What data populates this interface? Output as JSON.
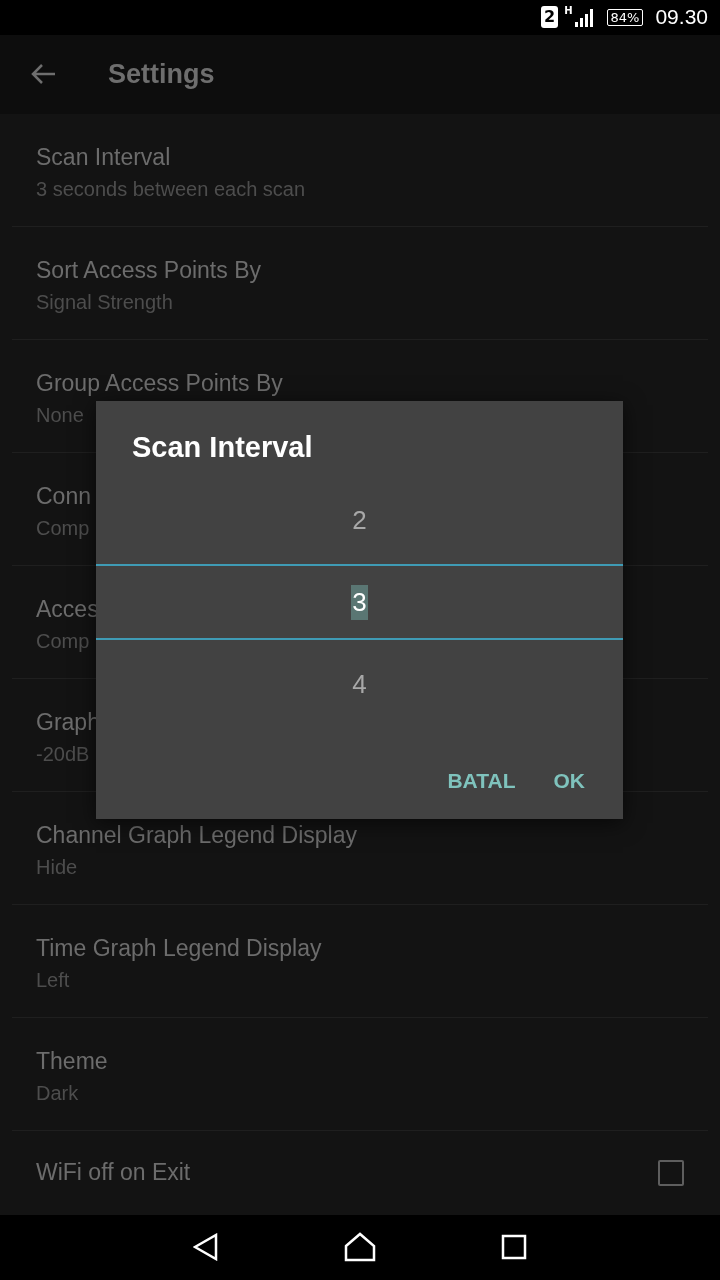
{
  "status_bar": {
    "sim": "2",
    "network": "H",
    "battery": "84%",
    "time": "09.30"
  },
  "toolbar": {
    "title": "Settings"
  },
  "settings": [
    {
      "kind": "text",
      "title": "Scan Interval",
      "summary": "3 seconds between each scan"
    },
    {
      "kind": "text",
      "title": "Sort Access Points By",
      "summary": "Signal Strength"
    },
    {
      "kind": "text",
      "title": "Group Access Points By",
      "summary": "None"
    },
    {
      "kind": "text",
      "title": "Conn",
      "summary": "Comp"
    },
    {
      "kind": "text",
      "title": "Acces",
      "summary": "Comp"
    },
    {
      "kind": "text",
      "title": "Graph",
      "summary": "-20dB"
    },
    {
      "kind": "text",
      "title": "Channel Graph Legend Display",
      "summary": "Hide"
    },
    {
      "kind": "text",
      "title": "Time Graph Legend Display",
      "summary": "Left"
    },
    {
      "kind": "text",
      "title": "Theme",
      "summary": "Dark"
    },
    {
      "kind": "checkbox",
      "title": "WiFi off on Exit",
      "checked": false
    }
  ],
  "dialog": {
    "title": "Scan Interval",
    "picker": [
      {
        "value": "2",
        "selected": false
      },
      {
        "value": "3",
        "selected": true
      },
      {
        "value": "4",
        "selected": false
      }
    ],
    "buttons": [
      "BATAL",
      "OK"
    ]
  }
}
